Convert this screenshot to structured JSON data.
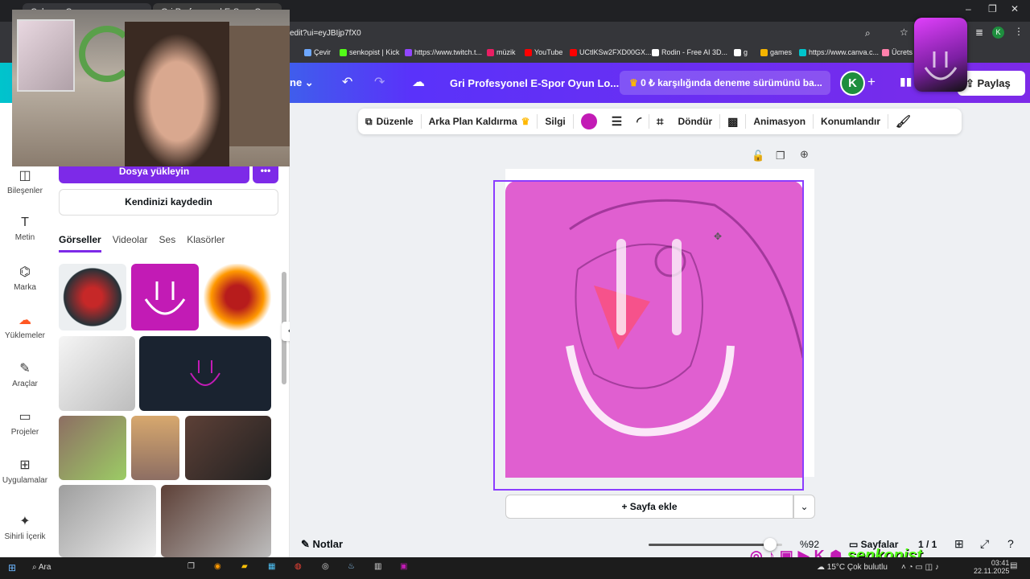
{
  "browser": {
    "tabs": [
      "Çalışma Canva",
      "Gri Profesyonel E-Spor Oyun..."
    ],
    "url": "edit?ui=eyJBIjp7fX0",
    "bookmarks": [
      "Çevir",
      "senkopist | Kick",
      "https://www.twitch.t...",
      "müzik",
      "YouTube",
      "UCtlKSw2FXD00GX...",
      "Rodin - Free AI 3D...",
      "g",
      "games",
      "https://www.canva.c...",
      "Ücrets"
    ],
    "bookmark_colors": [
      "#6ea8ff",
      "#53fc18",
      "#9146ff",
      "#e91e63",
      "#ff0000",
      "#ff0000",
      "#ffffff",
      "#ffffff",
      "#f4b400",
      "#00c4cc",
      "#ff80ab"
    ],
    "window_controls": [
      "–",
      "❐",
      "✕"
    ]
  },
  "canva_header": {
    "menu_label": "ne",
    "doc_title": "Gri Profesyonel  E-Spor Oyun Lo...",
    "trial_text": "0 ₺ karşılığında deneme sürümünü ba...",
    "avatar_letter": "K",
    "share_label": "Paylaş"
  },
  "sidebar": {
    "items": [
      {
        "label": "Bileşenler",
        "icon": "elements-icon"
      },
      {
        "label": "Metin",
        "icon": "text-icon"
      },
      {
        "label": "Marka",
        "icon": "brand-icon"
      },
      {
        "label": "Yüklemeler",
        "icon": "upload-cloud-icon"
      },
      {
        "label": "Araçlar",
        "icon": "tools-icon"
      },
      {
        "label": "Projeler",
        "icon": "folder-icon"
      },
      {
        "label": "Uygulamalar",
        "icon": "apps-icon"
      },
      {
        "label": "Sihirli İçerik",
        "icon": "magic-icon"
      }
    ]
  },
  "panel": {
    "upload_button": "Dosya yükleyin",
    "record_button": "Kendinizi kaydedin",
    "tabs": [
      "Görseller",
      "Videolar",
      "Ses",
      "Klasörler"
    ],
    "active_tab": "Görseller"
  },
  "toolbar": {
    "edit": "Düzenle",
    "bg_remove": "Arka Plan Kaldırma",
    "erase": "Silgi",
    "rotate": "Döndür",
    "animation": "Animasyon",
    "position": "Konumlandır",
    "accent_color": "#c21bb5"
  },
  "canvas": {
    "add_page": "+ Sayfa ekle",
    "notes": "Notlar",
    "zoom": "%92",
    "pages_label": "Sayfalar",
    "page_count": "1 / 1",
    "zoom_level": 0.92,
    "image_bg": "#e05fd0"
  },
  "taskbar": {
    "search": "Ara",
    "weather": "15°C  Çok bulutlu",
    "time": "03:41",
    "date": "22.11.2025",
    "stream_name": "senkopist"
  }
}
